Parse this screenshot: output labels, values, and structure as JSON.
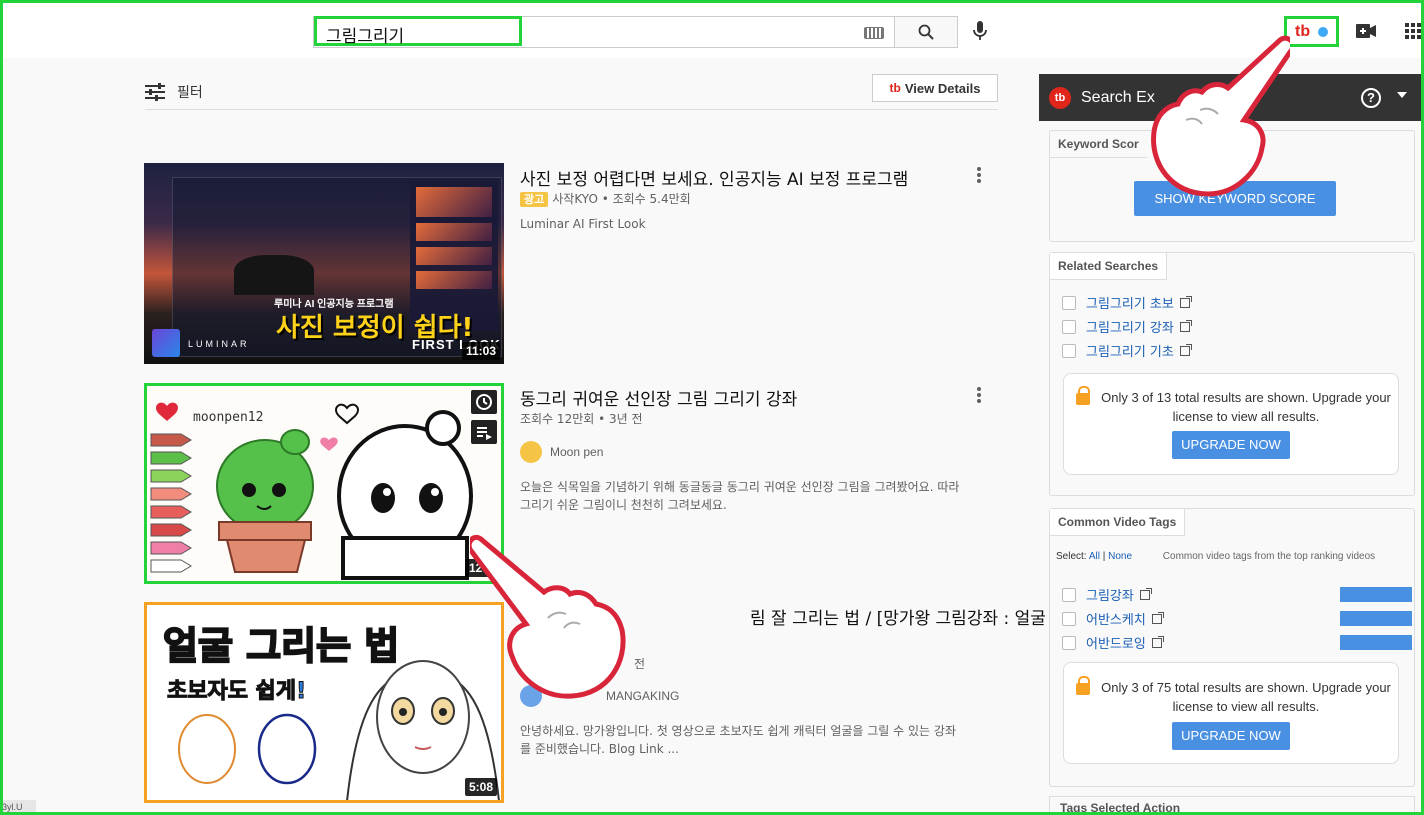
{
  "search": {
    "query": "그림그리기"
  },
  "filter": {
    "label": "필터",
    "view_details": "View Details"
  },
  "videos": [
    {
      "title": "사진 보정 어렵다면 보세요. 인공지능 AI 보정 프로그램",
      "ad_label": "광고",
      "meta": "사작KYO • 조회수 5.4만회",
      "subline": "Luminar AI First Look",
      "duration": "11:03",
      "thumb_caption_small": "루미나 AI 인공지능 프로그램",
      "thumb_caption_big": "사진 보정이 쉽다!",
      "thumb_caption_corner": "FIRST LOOK",
      "thumb_brand": "LUMINAR"
    },
    {
      "title": "동그리 귀여운 선인장 그림 그리기 강좌",
      "meta": "조회수 12만회 • 3년 전",
      "channel": "Moon pen",
      "desc_line1": "오늘은 식목일을 기념하기 위해 동글동글 동그리 귀여운 선인장 그림을 그려봤어요. 따라",
      "desc_line2": "그리기 쉬운 그림이니 천천히 그려보세요.",
      "duration": "12:2",
      "thumb_tag": "moonpen12"
    },
    {
      "title": "림 잘 그리는 법 / [망가왕 그림강좌 : 얼굴",
      "meta": "전",
      "channel": "MANGAKING",
      "desc_line1": "안녕하세요. 망가왕입니다. 첫 영상으로 초보자도 쉽게 캐릭터 얼굴을 그릴 수 있는 강좌",
      "desc_line2": "를 준비했습니다. Blog Link ...",
      "duration": "5:08",
      "thumb_big": "얼굴 그리는 법",
      "thumb_sub": "초보자도 쉽게!"
    }
  ],
  "sidebar": {
    "title": "Search Ex",
    "help": "?",
    "keyword_score": {
      "tab": "Keyword Scor",
      "button": "SHOW KEYWORD SCORE"
    },
    "related": {
      "tab": "Related Searches",
      "items": [
        "그림그리기 초보",
        "그림그리기 강좌",
        "그림그리기 기초"
      ],
      "notice": "Only 3 of 13 total results are shown. Upgrade your license to view all results.",
      "upgrade": "UPGRADE NOW"
    },
    "tags": {
      "tab": "Common Video Tags",
      "select_label": "Select:",
      "all": "All",
      "sep": "|",
      "none": "None",
      "hint": "Common video tags from the top ranking videos",
      "items": [
        "그림강좌",
        "어반스케치",
        "어반드로잉"
      ],
      "notice": "Only 3 of 75 total results are shown. Upgrade your license to view all results.",
      "upgrade": "UPGRADE NOW"
    },
    "bottom_tab": "Tags Selected  Action"
  },
  "status": {
    "tip": "3yl.U"
  },
  "colors": {
    "highlight": "#22d33a",
    "accent": "#4a90e2",
    "tubebuddy": "#e0251b"
  }
}
